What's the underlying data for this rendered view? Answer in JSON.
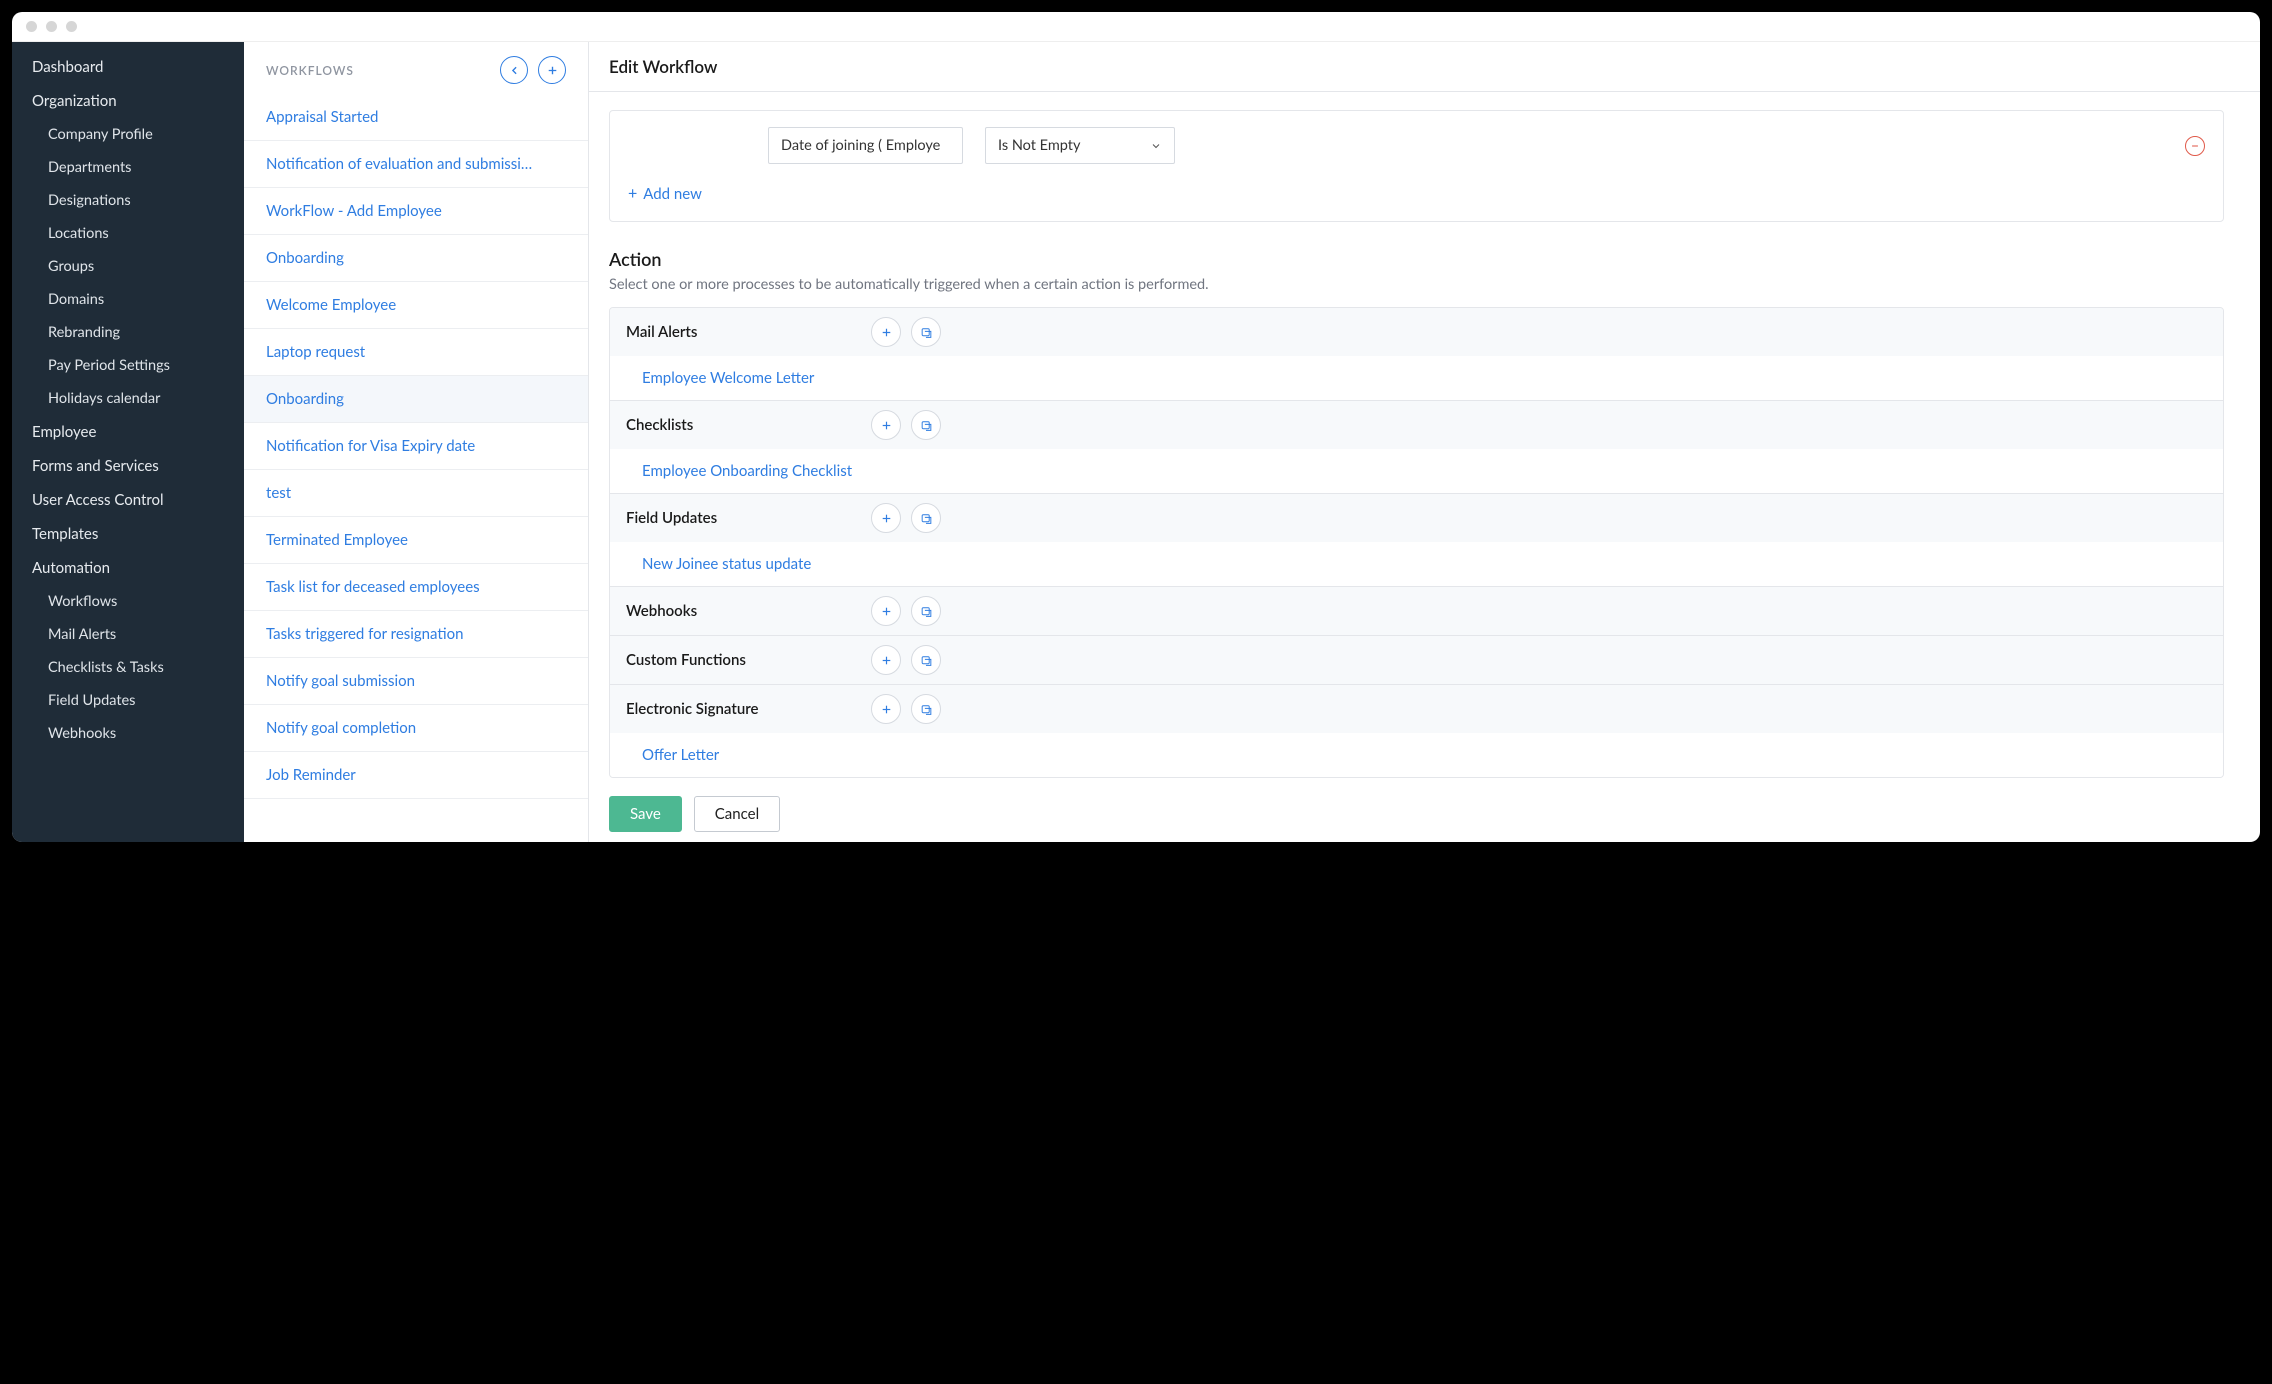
{
  "sidebar": {
    "items": [
      {
        "label": "Dashboard",
        "sub": false
      },
      {
        "label": "Organization",
        "sub": false
      },
      {
        "label": "Company Profile",
        "sub": true
      },
      {
        "label": "Departments",
        "sub": true
      },
      {
        "label": "Designations",
        "sub": true
      },
      {
        "label": "Locations",
        "sub": true
      },
      {
        "label": "Groups",
        "sub": true
      },
      {
        "label": "Domains",
        "sub": true
      },
      {
        "label": "Rebranding",
        "sub": true
      },
      {
        "label": "Pay Period Settings",
        "sub": true
      },
      {
        "label": "Holidays calendar",
        "sub": true
      },
      {
        "label": "Employee",
        "sub": false
      },
      {
        "label": "Forms and Services",
        "sub": false
      },
      {
        "label": "User Access Control",
        "sub": false
      },
      {
        "label": "Templates",
        "sub": false
      },
      {
        "label": "Automation",
        "sub": false
      },
      {
        "label": "Workflows",
        "sub": true
      },
      {
        "label": "Mail Alerts",
        "sub": true
      },
      {
        "label": "Checklists & Tasks",
        "sub": true
      },
      {
        "label": "Field Updates",
        "sub": true
      },
      {
        "label": "Webhooks",
        "sub": true
      }
    ]
  },
  "mid": {
    "title": "WORKFLOWS",
    "items": [
      {
        "label": "Appraisal Started",
        "active": false
      },
      {
        "label": "Notification of evaluation and submissi…",
        "active": false
      },
      {
        "label": "WorkFlow - Add Employee",
        "active": false
      },
      {
        "label": "Onboarding",
        "active": false
      },
      {
        "label": "Welcome Employee",
        "active": false
      },
      {
        "label": "Laptop request",
        "active": false
      },
      {
        "label": "Onboarding",
        "active": true
      },
      {
        "label": "Notification for Visa Expiry date",
        "active": false
      },
      {
        "label": "test",
        "active": false
      },
      {
        "label": "Terminated Employee",
        "active": false
      },
      {
        "label": "Task list for deceased employees",
        "active": false
      },
      {
        "label": "Tasks triggered for resignation",
        "active": false
      },
      {
        "label": "Notify goal submission",
        "active": false
      },
      {
        "label": "Notify goal completion",
        "active": false
      },
      {
        "label": "Job Reminder",
        "active": false
      }
    ]
  },
  "right": {
    "title": "Edit Workflow",
    "criteria": {
      "field": "Date of joining ( Employe",
      "operator": "Is Not Empty",
      "add_new": "Add new"
    },
    "action": {
      "title": "Action",
      "desc": "Select one or more processes to be automatically triggered when a certain action is performed.",
      "groups": [
        {
          "label": "Mail Alerts",
          "children": [
            "Employee Welcome Letter"
          ]
        },
        {
          "label": "Checklists",
          "children": [
            "Employee Onboarding Checklist"
          ]
        },
        {
          "label": "Field Updates",
          "children": [
            "New Joinee status update"
          ]
        },
        {
          "label": "Webhooks",
          "children": []
        },
        {
          "label": "Custom Functions",
          "children": []
        },
        {
          "label": "Electronic Signature",
          "children": [
            "Offer Letter"
          ]
        }
      ]
    },
    "buttons": {
      "save": "Save",
      "cancel": "Cancel"
    }
  }
}
